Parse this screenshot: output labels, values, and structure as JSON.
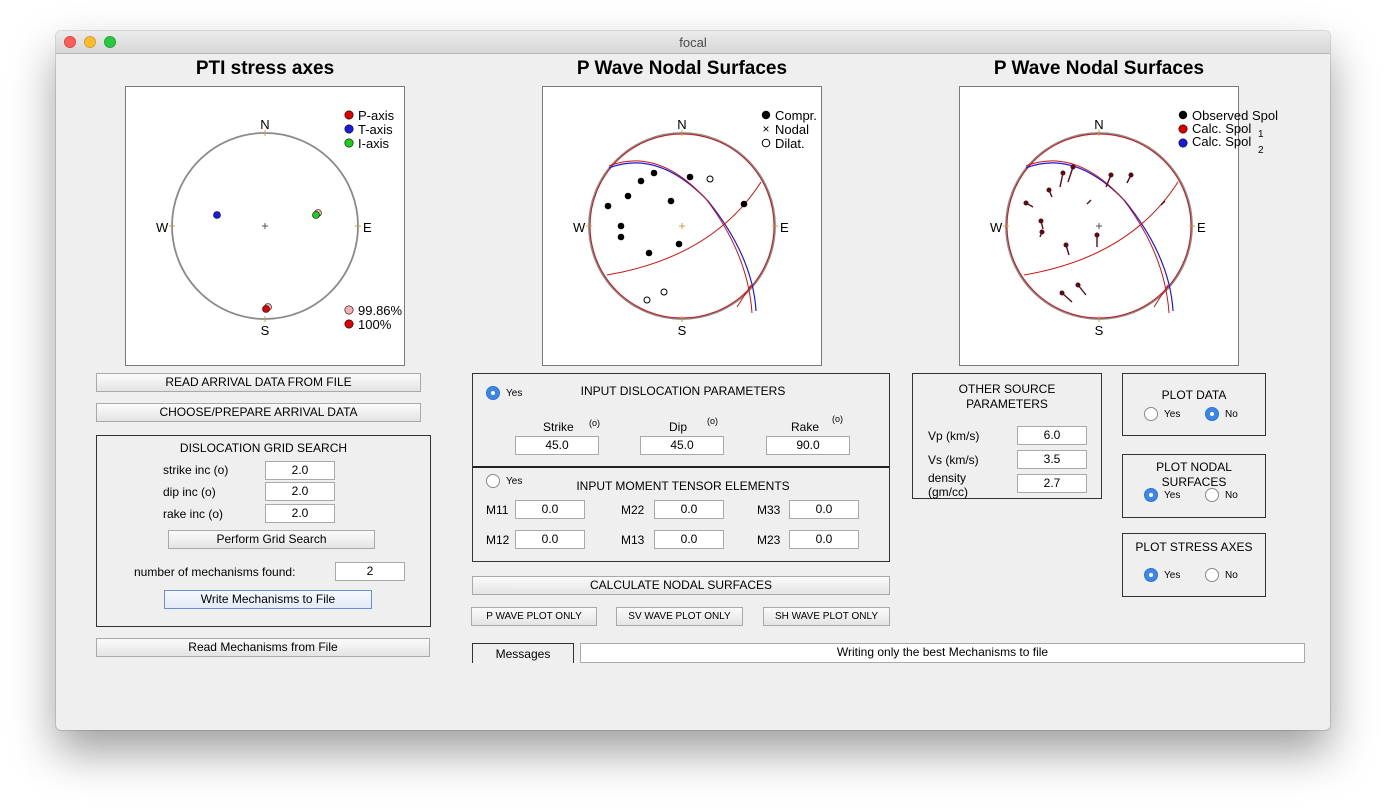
{
  "window": {
    "title": "focal"
  },
  "plots": {
    "pti": {
      "title": "PTI stress axes",
      "directions": {
        "n": "N",
        "s": "S",
        "e": "E",
        "w": "W"
      },
      "legend": [
        "P-axis",
        "T-axis",
        "I-axis"
      ],
      "legend_colors": [
        "#e00000",
        "#1a1ae0",
        "#1ad01a"
      ],
      "percent_legend": [
        "99.86%",
        "100%"
      ],
      "percent_colors": [
        "#f4b0b0",
        "#e00000"
      ]
    },
    "pwave": {
      "title": "P Wave Nodal Surfaces",
      "directions": {
        "n": "N",
        "s": "S",
        "e": "E",
        "w": "W"
      },
      "legend": [
        "Compr.",
        "Nodal",
        "Dilat."
      ]
    },
    "spol": {
      "title": "P Wave Nodal Surfaces",
      "directions": {
        "n": "N",
        "s": "S",
        "e": "E",
        "w": "W"
      },
      "legend": [
        "Observed Spol",
        "Calc. Spol",
        "Calc. Spol"
      ],
      "legend_subscripts": [
        "1",
        "2"
      ],
      "legend_colors": [
        "#000000",
        "#e00000",
        "#1a1ae0"
      ]
    }
  },
  "left": {
    "read_arrival_label": "READ ARRIVAL DATA FROM FILE",
    "choose_arrival_label": "CHOOSE/PREPARE ARRIVAL DATA",
    "grid_search": {
      "title": "DISLOCATION GRID SEARCH",
      "strike_label": "strike inc (o)",
      "strike_value": "2.0",
      "dip_label": "dip inc (o)",
      "dip_value": "2.0",
      "rake_label": "rake inc (o)",
      "rake_value": "2.0",
      "perform_label": "Perform Grid Search",
      "found_label": "number of mechanisms found:",
      "found_value": "2",
      "write_label": "Write Mechanisms to File"
    },
    "read_mech_label": "Read Mechanisms from File"
  },
  "dislocation": {
    "yes_label": "Yes",
    "title": "INPUT DISLOCATION PARAMETERS",
    "strike_label": "Strike",
    "dip_label": "Dip",
    "rake_label": "Rake",
    "unit": "(o)",
    "strike_value": "45.0",
    "dip_value": "45.0",
    "rake_value": "90.0"
  },
  "moment": {
    "yes_label": "Yes",
    "title": "INPUT MOMENT TENSOR ELEMENTS",
    "m11_label": "M11",
    "m11_value": "0.0",
    "m22_label": "M22",
    "m22_value": "0.0",
    "m33_label": "M33",
    "m33_value": "0.0",
    "m12_label": "M12",
    "m12_value": "0.0",
    "m13_label": "M13",
    "m13_value": "0.0",
    "m23_label": "M23",
    "m23_value": "0.0"
  },
  "actions": {
    "calculate_label": "CALCULATE NODAL SURFACES",
    "p_only_label": "P WAVE PLOT ONLY",
    "sv_only_label": "SV WAVE PLOT ONLY",
    "sh_only_label": "SH WAVE PLOT ONLY"
  },
  "source": {
    "title": "OTHER SOURCE PARAMETERS",
    "vp_label": "Vp (km/s)",
    "vp_value": "6.0",
    "vs_label": "Vs (km/s)",
    "vs_value": "3.5",
    "density_label": "density (gm/cc)",
    "density_value": "2.7"
  },
  "options": {
    "plot_data": {
      "title": "PLOT DATA",
      "yes": "Yes",
      "no": "No",
      "selected": "No"
    },
    "plot_nodal": {
      "title": "PLOT NODAL SURFACES",
      "yes": "Yes",
      "no": "No",
      "selected": "Yes"
    },
    "plot_stress": {
      "title": "PLOT STRESS AXES",
      "yes": "Yes",
      "no": "No",
      "selected": "Yes"
    }
  },
  "messages": {
    "tab_label": "Messages",
    "text": "Writing only the best Mechanisms to file"
  }
}
